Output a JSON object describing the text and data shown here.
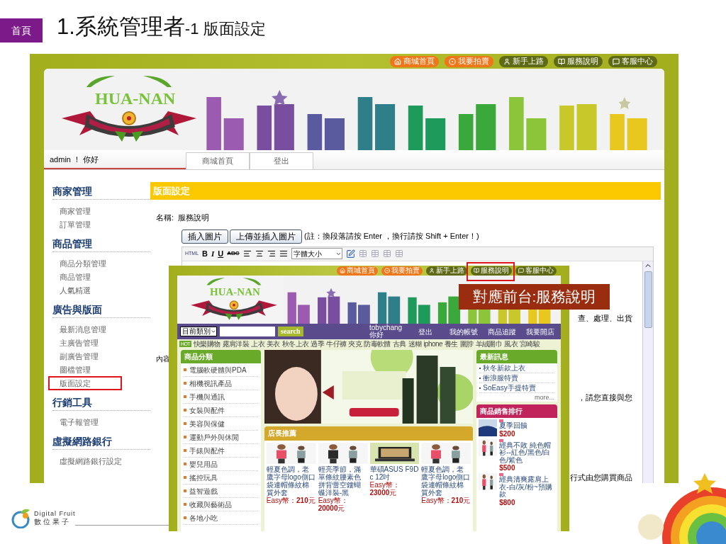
{
  "slide": {
    "home_badge": "首頁",
    "title_main": "1.系統管理者",
    "title_sub": "-1 版面設定",
    "callout": "對應前台:服務說明",
    "footer_name": "Digital Fruit",
    "footer_name_zh": "數位果子"
  },
  "admin": {
    "top_links": [
      {
        "label": "商城首頁",
        "kind": "home",
        "color": "#f0761a",
        "annotated": false
      },
      {
        "label": "我要拍賣",
        "kind": "bid",
        "color": "#f0761a",
        "annotated": false
      },
      {
        "label": "新手上路",
        "kind": "guide",
        "color": "#5f6a16",
        "annotated": false
      },
      {
        "label": "服務說明",
        "kind": "service",
        "color": "#5f6a16",
        "annotated": false
      },
      {
        "label": "客服中心",
        "kind": "support",
        "color": "#5f6a16",
        "annotated": false
      }
    ],
    "logo": "HUA-NAN",
    "greeting": "admin ！ 你好",
    "nav_tabs": [
      "商城首頁",
      "登出"
    ],
    "sidebar": [
      {
        "title": "商家管理",
        "items": [
          {
            "label": "商家管理",
            "annotated": false
          },
          {
            "label": "訂單管理",
            "annotated": false
          }
        ]
      },
      {
        "title": "商品管理",
        "items": [
          {
            "label": "商品分類管理",
            "annotated": false
          },
          {
            "label": "商品管理",
            "annotated": false
          },
          {
            "label": "人氣精選",
            "annotated": false
          }
        ]
      },
      {
        "title": "廣告與版面",
        "items": [
          {
            "label": "最新消息管理",
            "annotated": false
          },
          {
            "label": "主廣告管理",
            "annotated": false
          },
          {
            "label": "副廣告管理",
            "annotated": false
          },
          {
            "label": "圖檔管理",
            "annotated": false
          },
          {
            "label": "版面設定",
            "annotated": true
          }
        ]
      },
      {
        "title": "行銷工具",
        "items": [
          {
            "label": "電子報管理",
            "annotated": false
          }
        ]
      },
      {
        "title": "虛擬網路銀行",
        "items": [
          {
            "label": "虛擬網路銀行設定",
            "annotated": false
          }
        ]
      }
    ],
    "page_header": "版面設定",
    "name_label": "名稱:",
    "name_value": "服務說明",
    "buttons": [
      "插入圖片",
      "上傳並插入圖片"
    ],
    "note": "(註：換段落請按 Enter ，換行請按 Shift + Enter！)",
    "toolbar": {
      "html": "HTML",
      "bold": "B",
      "italic": "I",
      "underline": "U",
      "strike": "ABC",
      "font_size": "字體大小"
    },
    "content_label": "內容",
    "editor_fragments": [
      "查、處理、出貨",
      "，請您直接與您",
      "行式由您購買商品"
    ]
  },
  "front": {
    "top_links": [
      {
        "label": "商城首頁",
        "kind": "home",
        "color": "#f0761a",
        "annotated": false
      },
      {
        "label": "我要拍賣",
        "kind": "bid",
        "color": "#f0761a",
        "annotated": false
      },
      {
        "label": "新手上路",
        "kind": "guide",
        "color": "#5f6a16",
        "annotated": false
      },
      {
        "label": "服務說明",
        "kind": "service",
        "color": "#5f6a16",
        "annotated": true
      },
      {
        "label": "客服中心",
        "kind": "support",
        "color": "#5f6a16",
        "annotated": false
      }
    ],
    "logo": "HUA-NAN",
    "category_select": "目前類別",
    "search_button": "search",
    "user_name": "tobychang",
    "user_greeting": "你好",
    "nav_links": [
      "登出",
      "我的帳號",
      "商品追蹤",
      "我要開店"
    ],
    "hot_badge": "HOT",
    "hot_keywords": [
      "快樂購物",
      "露肩洋裝",
      "上衣",
      "美衣",
      "秋冬上衣",
      "過季",
      "牛仔褲",
      "夾克",
      "防毒軟體",
      "古典",
      "迷糊",
      "iphone",
      "養生",
      "圍脖",
      "羊絨圍巾",
      "風衣",
      "宮崎駿"
    ],
    "categories_title": "商品分類",
    "categories": [
      "電腦軟硬體與PDA",
      "相機視訊產品",
      "手機與通訊",
      "女裝與配件",
      "美容與保健",
      "運動戶外與休閒",
      "手錶與配件",
      "嬰兒用品",
      "搖控玩具",
      "益智遊戲",
      "收藏與藝術品",
      "各地小吃"
    ],
    "recommend_title": "店長推薦",
    "products": [
      {
        "name": "輕夏色調，老鷹字母logo側口袋連帽條紋棉質外套",
        "price_label": "Easy幣：",
        "price": "210",
        "unit": "元"
      },
      {
        "name": "輕亮季節，滿單條紋腰素色拼背蕾空鏤蝴蝶洋裝-黑",
        "price_label": "Easy幣：",
        "price": "20000",
        "unit": "元"
      },
      {
        "name": "華碩ASUS F9Dc 12吋",
        "price_label": "Easy幣：",
        "price": "23000",
        "unit": "元"
      },
      {
        "name": "輕夏色調，老鷹字母logo側口袋連帽條紋棉質外套",
        "price_label": "Easy幣：",
        "price": "210",
        "unit": "元"
      }
    ],
    "news_title": "最新訊息",
    "news": [
      "秋冬新款上衣",
      "衝浪服特賣",
      "SoEasy手提特賣"
    ],
    "news_more": "more...",
    "ranking_title": "商品銷售排行",
    "ranking": [
      {
        "name": "夏季回饋",
        "price": "$200"
      },
      {
        "name": "經典不敗 純色帽衫--紅色/黑色/白色/紫色",
        "price": "$500"
      },
      {
        "name": "經典清爽露肩上衣-白/灰/粉~預購款",
        "price": "$800"
      }
    ]
  }
}
